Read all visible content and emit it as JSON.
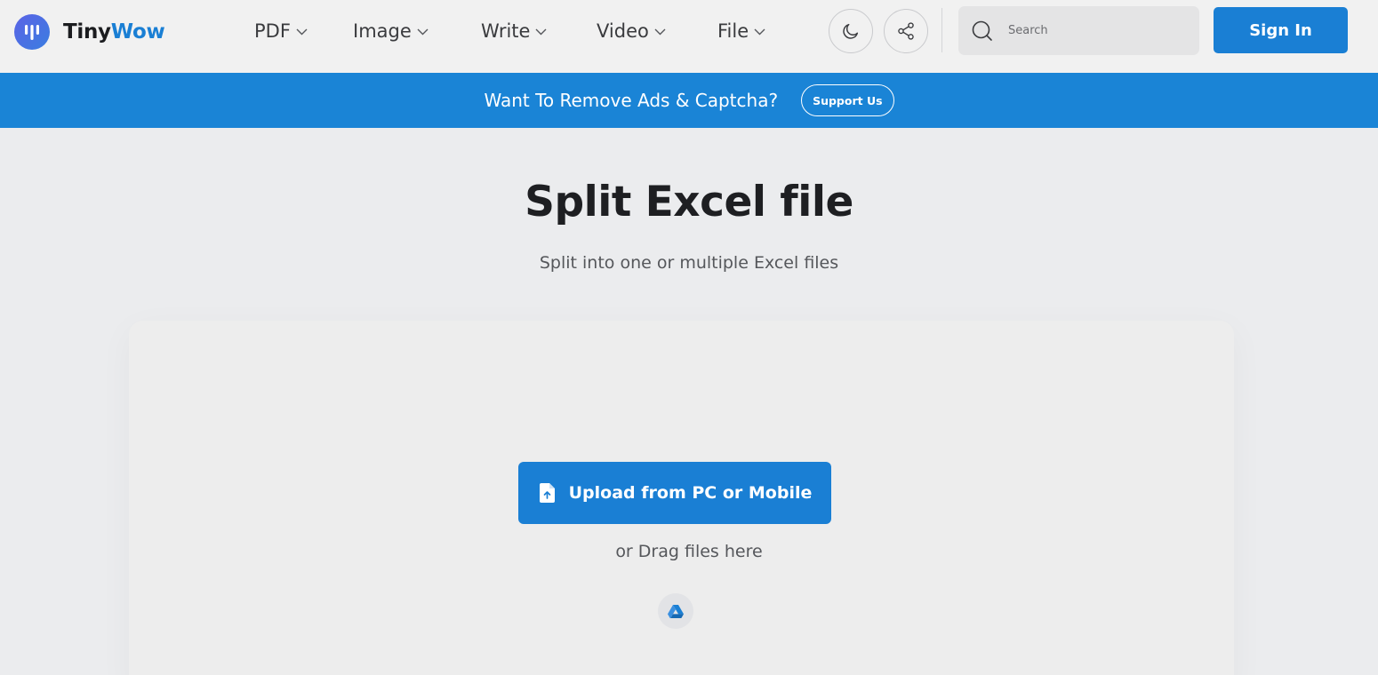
{
  "header": {
    "logo": {
      "part1": "Tiny",
      "part2": "Wow"
    },
    "nav": [
      {
        "label": "PDF"
      },
      {
        "label": "Image"
      },
      {
        "label": "Write"
      },
      {
        "label": "Video"
      },
      {
        "label": "File"
      }
    ],
    "search": {
      "placeholder": "Search",
      "value": ""
    },
    "sign_in_label": "Sign In"
  },
  "banner": {
    "text": "Want To Remove Ads & Captcha?",
    "button_label": "Support Us"
  },
  "main": {
    "title": "Split Excel file",
    "subtitle": "Split into one or multiple Excel files",
    "upload_label": "Upload from PC or Mobile",
    "drag_text": "or Drag files here"
  },
  "colors": {
    "accent": "#1a7fd4",
    "banner": "#1a84d6",
    "page_bg": "#ebecee",
    "header_bg": "#f1f1f1"
  },
  "icons": {
    "logo": "tinywow-logo-icon",
    "theme": "moon-icon",
    "share": "share-icon",
    "search": "search-icon",
    "upload": "file-upload-icon",
    "drive": "google-drive-icon"
  }
}
